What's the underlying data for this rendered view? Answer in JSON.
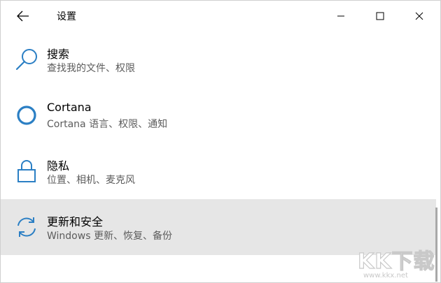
{
  "window": {
    "title": "设置",
    "accent_color": "#2b7fc4",
    "hover_bg": "#e6e6e6"
  },
  "titlebar": {
    "back_icon": "back-arrow-icon",
    "minimize_icon": "minimize-icon",
    "maximize_icon": "maximize-icon",
    "close_icon": "close-icon"
  },
  "items": [
    {
      "label": "搜索",
      "desc": "查找我的文件、权限",
      "icon": "search-icon"
    },
    {
      "label": "Cortana",
      "desc": "Cortana 语言、权限、通知",
      "icon": "cortana-icon"
    },
    {
      "label": "隐私",
      "desc": "位置、相机、麦克风",
      "icon": "lock-icon"
    },
    {
      "label": "更新和安全",
      "desc": "Windows 更新、恢复、备份",
      "icon": "sync-icon"
    }
  ],
  "watermark": {
    "logo": "KK下载",
    "url": "www.kkx.net"
  }
}
